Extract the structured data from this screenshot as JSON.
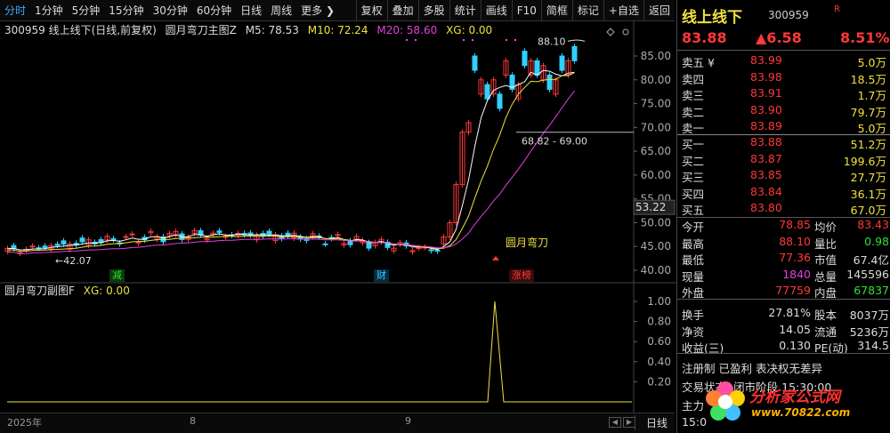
{
  "toolbar": {
    "left": [
      "分时",
      "1分钟",
      "5分钟",
      "15分钟",
      "30分钟",
      "60分钟",
      "日线",
      "周线",
      "更多 ❯"
    ],
    "right": [
      "复权",
      "叠加",
      "多股",
      "统计",
      "画线",
      "F10",
      "简框",
      "标记",
      "+自选",
      "返回"
    ]
  },
  "main_header": {
    "stock": "300959 线上线下(日线,前复权)",
    "indicator": "圆月弯刀主图Z",
    "m5": "M5: 78.53",
    "m10": "M10: 72.24",
    "m20": "M20: 58.60",
    "xg": "XG: 0.00"
  },
  "sub_header": {
    "indicator": "圆月弯刀副图F",
    "xg": "XG: 0.00"
  },
  "chart_labels": {
    "high": "88.10",
    "range": "68.82 - 69.00",
    "low": "←42.07",
    "current_axis": "53.22",
    "signal": "圆月弯刀",
    "tag_reduce": "减",
    "tag_fin": "财",
    "tag_zhangbang": "涨榜"
  },
  "axis": {
    "main_ticks": [
      "85.00",
      "80.00",
      "75.00",
      "70.00",
      "65.00",
      "60.00",
      "55.00",
      "50.00",
      "45.00",
      "40.00"
    ],
    "sub_ticks": [
      "1.00",
      "0.80",
      "0.60",
      "0.40",
      "0.20"
    ]
  },
  "bottom": {
    "dates": [
      "2025年",
      "8",
      "9"
    ],
    "mode": "日线",
    "scroll_left": "◀",
    "scroll_right": "▶"
  },
  "quote": {
    "name": "线上线下",
    "code": "300959",
    "r_mark": "R",
    "price": "83.88",
    "change": "▲6.58",
    "pct": "8.51%",
    "sells": [
      {
        "label": "卖五 ¥",
        "price": "83.99",
        "vol": "5.0万"
      },
      {
        "label": "卖四",
        "price": "83.98",
        "vol": "18.5万"
      },
      {
        "label": "卖三",
        "price": "83.91",
        "vol": "1.7万"
      },
      {
        "label": "卖二",
        "price": "83.90",
        "vol": "79.7万"
      },
      {
        "label": "卖一",
        "price": "83.89",
        "vol": "5.0万"
      }
    ],
    "buys": [
      {
        "label": "买一",
        "price": "83.88",
        "vol": "51.2万"
      },
      {
        "label": "买二",
        "price": "83.87",
        "vol": "199.6万"
      },
      {
        "label": "买三",
        "price": "83.85",
        "vol": "27.7万"
      },
      {
        "label": "买四",
        "price": "83.84",
        "vol": "36.1万"
      },
      {
        "label": "买五",
        "price": "83.80",
        "vol": "67.0万"
      }
    ],
    "stats": [
      {
        "l1": "今开",
        "v1": "78.85",
        "c1": "red",
        "l2": "均价",
        "v2": "83.43",
        "c2": "red"
      },
      {
        "l1": "最高",
        "v1": "88.10",
        "c1": "red",
        "l2": "量比",
        "v2": "0.98",
        "c2": "green"
      },
      {
        "l1": "最低",
        "v1": "77.36",
        "c1": "red",
        "l2": "市值",
        "v2": "67.4亿",
        "c2": "white"
      },
      {
        "l1": "现量",
        "v1": "1840",
        "c1": "magenta",
        "l2": "总量",
        "v2": "145596",
        "c2": "white"
      },
      {
        "l1": "外盘",
        "v1": "77759",
        "c1": "red",
        "l2": "内盘",
        "v2": "67837",
        "c2": "green"
      },
      {
        "l1": "换手",
        "v1": "27.81%",
        "c1": "white",
        "l2": "股本",
        "v2": "8037万",
        "c2": "white"
      },
      {
        "l1": "净资",
        "v1": "14.05",
        "c1": "white",
        "l2": "流通",
        "v2": "5236万",
        "c2": "white"
      },
      {
        "l1": "收益(三)",
        "v1": "0.130",
        "c1": "white",
        "l2": "PE(动)",
        "v2": "314.5",
        "c2": "white"
      }
    ],
    "tag_line1": "注册制  已盈利  表决权无差异",
    "tag_line2": "交易状态: 闭市阶段 15:30:00",
    "tag_line3": "主力",
    "tag_line4": "15:0"
  },
  "logo": {
    "name": "分析家公式网",
    "url": "www.70822.com"
  },
  "colors": {
    "up": "#ff3838",
    "down": "#30d0ff",
    "ma5": "#ffffff",
    "ma10": "#f0e040",
    "ma20": "#e040e0"
  }
}
